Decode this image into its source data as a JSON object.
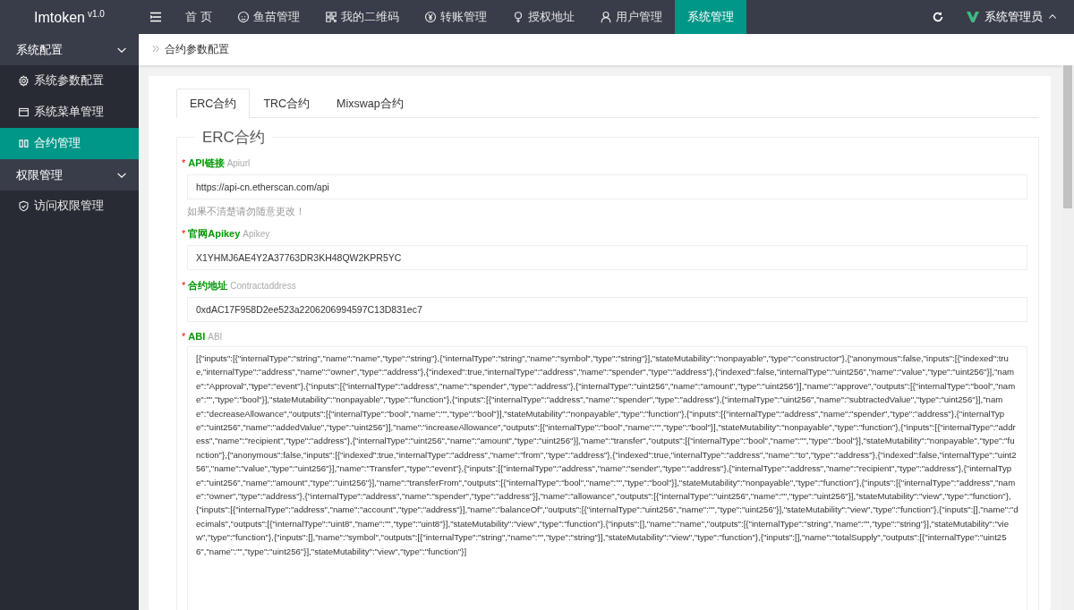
{
  "app": {
    "name": "Imtoken",
    "version": "v1.0"
  },
  "nav": [
    {
      "label": "首 页",
      "selected": false
    },
    {
      "label": "鱼苗管理",
      "selected": false
    },
    {
      "label": "我的二维码",
      "selected": false
    },
    {
      "label": "转账管理",
      "selected": false
    },
    {
      "label": "授权地址",
      "selected": false
    },
    {
      "label": "用户管理",
      "selected": false
    },
    {
      "label": "系统管理",
      "selected": true
    }
  ],
  "user": {
    "name": "系统管理员"
  },
  "sidebar": {
    "groups": [
      {
        "label": "系统配置",
        "expanded": true,
        "children": [
          {
            "label": "系统参数配置",
            "selected": false
          },
          {
            "label": "系统菜单管理",
            "selected": false
          },
          {
            "label": "合约管理",
            "selected": true
          }
        ]
      },
      {
        "label": "权限管理",
        "expanded": true,
        "children": [
          {
            "label": "访问权限管理",
            "selected": false
          }
        ]
      }
    ]
  },
  "breadcrumb": "合约参数配置",
  "tabs": [
    {
      "label": "ERC合约",
      "selected": true
    },
    {
      "label": "TRC合约",
      "selected": false
    },
    {
      "label": "Mixswap合约",
      "selected": false
    }
  ],
  "form": {
    "legend": "ERC合约",
    "fields": [
      {
        "kind": "input",
        "label": "API链接",
        "hint": "Apiurl",
        "required_mark": "*",
        "value": "https://api-cn.etherscan.com/api",
        "note": "如果不清楚请勿随意更改！"
      },
      {
        "kind": "input",
        "label": "官网Apikey",
        "hint": "Apikey",
        "required_mark": "*",
        "value": "X1YHMJ6AE4Y2A37763DR3KH48QW2KPR5YC"
      },
      {
        "kind": "input",
        "label": "合约地址",
        "hint": "Contractaddress",
        "required_mark": "*",
        "value": "0xdAC17F958D2ee523a2206206994597C13D831ec7"
      },
      {
        "kind": "textarea",
        "label": "ABI",
        "hint": "ABI",
        "required_mark": "*",
        "value": "[{\"inputs\":[{\"internalType\":\"string\",\"name\":\"name\",\"type\":\"string\"},{\"internalType\":\"string\",\"name\":\"symbol\",\"type\":\"string\"}],\"stateMutability\":\"nonpayable\",\"type\":\"constructor\"},{\"anonymous\":false,\"inputs\":[{\"indexed\":true,\"internalType\":\"address\",\"name\":\"owner\",\"type\":\"address\"},{\"indexed\":true,\"internalType\":\"address\",\"name\":\"spender\",\"type\":\"address\"},{\"indexed\":false,\"internalType\":\"uint256\",\"name\":\"value\",\"type\":\"uint256\"}],\"name\":\"Approval\",\"type\":\"event\"},{\"inputs\":[{\"internalType\":\"address\",\"name\":\"spender\",\"type\":\"address\"},{\"internalType\":\"uint256\",\"name\":\"amount\",\"type\":\"uint256\"}],\"name\":\"approve\",\"outputs\":[{\"internalType\":\"bool\",\"name\":\"\",\"type\":\"bool\"}],\"stateMutability\":\"nonpayable\",\"type\":\"function\"},{\"inputs\":[{\"internalType\":\"address\",\"name\":\"spender\",\"type\":\"address\"},{\"internalType\":\"uint256\",\"name\":\"subtractedValue\",\"type\":\"uint256\"}],\"name\":\"decreaseAllowance\",\"outputs\":[{\"internalType\":\"bool\",\"name\":\"\",\"type\":\"bool\"}],\"stateMutability\":\"nonpayable\",\"type\":\"function\"},{\"inputs\":[{\"internalType\":\"address\",\"name\":\"spender\",\"type\":\"address\"},{\"internalType\":\"uint256\",\"name\":\"addedValue\",\"type\":\"uint256\"}],\"name\":\"increaseAllowance\",\"outputs\":[{\"internalType\":\"bool\",\"name\":\"\",\"type\":\"bool\"}],\"stateMutability\":\"nonpayable\",\"type\":\"function\"},{\"inputs\":[{\"internalType\":\"address\",\"name\":\"recipient\",\"type\":\"address\"},{\"internalType\":\"uint256\",\"name\":\"amount\",\"type\":\"uint256\"}],\"name\":\"transfer\",\"outputs\":[{\"internalType\":\"bool\",\"name\":\"\",\"type\":\"bool\"}],\"stateMutability\":\"nonpayable\",\"type\":\"function\"},{\"anonymous\":false,\"inputs\":[{\"indexed\":true,\"internalType\":\"address\",\"name\":\"from\",\"type\":\"address\"},{\"indexed\":true,\"internalType\":\"address\",\"name\":\"to\",\"type\":\"address\"},{\"indexed\":false,\"internalType\":\"uint256\",\"name\":\"value\",\"type\":\"uint256\"}],\"name\":\"Transfer\",\"type\":\"event\"},{\"inputs\":[{\"internalType\":\"address\",\"name\":\"sender\",\"type\":\"address\"},{\"internalType\":\"address\",\"name\":\"recipient\",\"type\":\"address\"},{\"internalType\":\"uint256\",\"name\":\"amount\",\"type\":\"uint256\"}],\"name\":\"transferFrom\",\"outputs\":[{\"internalType\":\"bool\",\"name\":\"\",\"type\":\"bool\"}],\"stateMutability\":\"nonpayable\",\"type\":\"function\"},{\"inputs\":[{\"internalType\":\"address\",\"name\":\"owner\",\"type\":\"address\"},{\"internalType\":\"address\",\"name\":\"spender\",\"type\":\"address\"}],\"name\":\"allowance\",\"outputs\":[{\"internalType\":\"uint256\",\"name\":\"\",\"type\":\"uint256\"}],\"stateMutability\":\"view\",\"type\":\"function\"},{\"inputs\":[{\"internalType\":\"address\",\"name\":\"account\",\"type\":\"address\"}],\"name\":\"balanceOf\",\"outputs\":[{\"internalType\":\"uint256\",\"name\":\"\",\"type\":\"uint256\"}],\"stateMutability\":\"view\",\"type\":\"function\"},{\"inputs\":[],\"name\":\"decimals\",\"outputs\":[{\"internalType\":\"uint8\",\"name\":\"\",\"type\":\"uint8\"}],\"stateMutability\":\"view\",\"type\":\"function\"},{\"inputs\":[],\"name\":\"name\",\"outputs\":[{\"internalType\":\"string\",\"name\":\"\",\"type\":\"string\"}],\"stateMutability\":\"view\",\"type\":\"function\"},{\"inputs\":[],\"name\":\"symbol\",\"outputs\":[{\"internalType\":\"string\",\"name\":\"\",\"type\":\"string\"}],\"stateMutability\":\"view\",\"type\":\"function\"},{\"inputs\":[],\"name\":\"totalSupply\",\"outputs\":[{\"internalType\":\"uint256\",\"name\":\"\",\"type\":\"uint256\"}],\"stateMutability\":\"view\",\"type\":\"function\"}]"
      }
    ]
  }
}
